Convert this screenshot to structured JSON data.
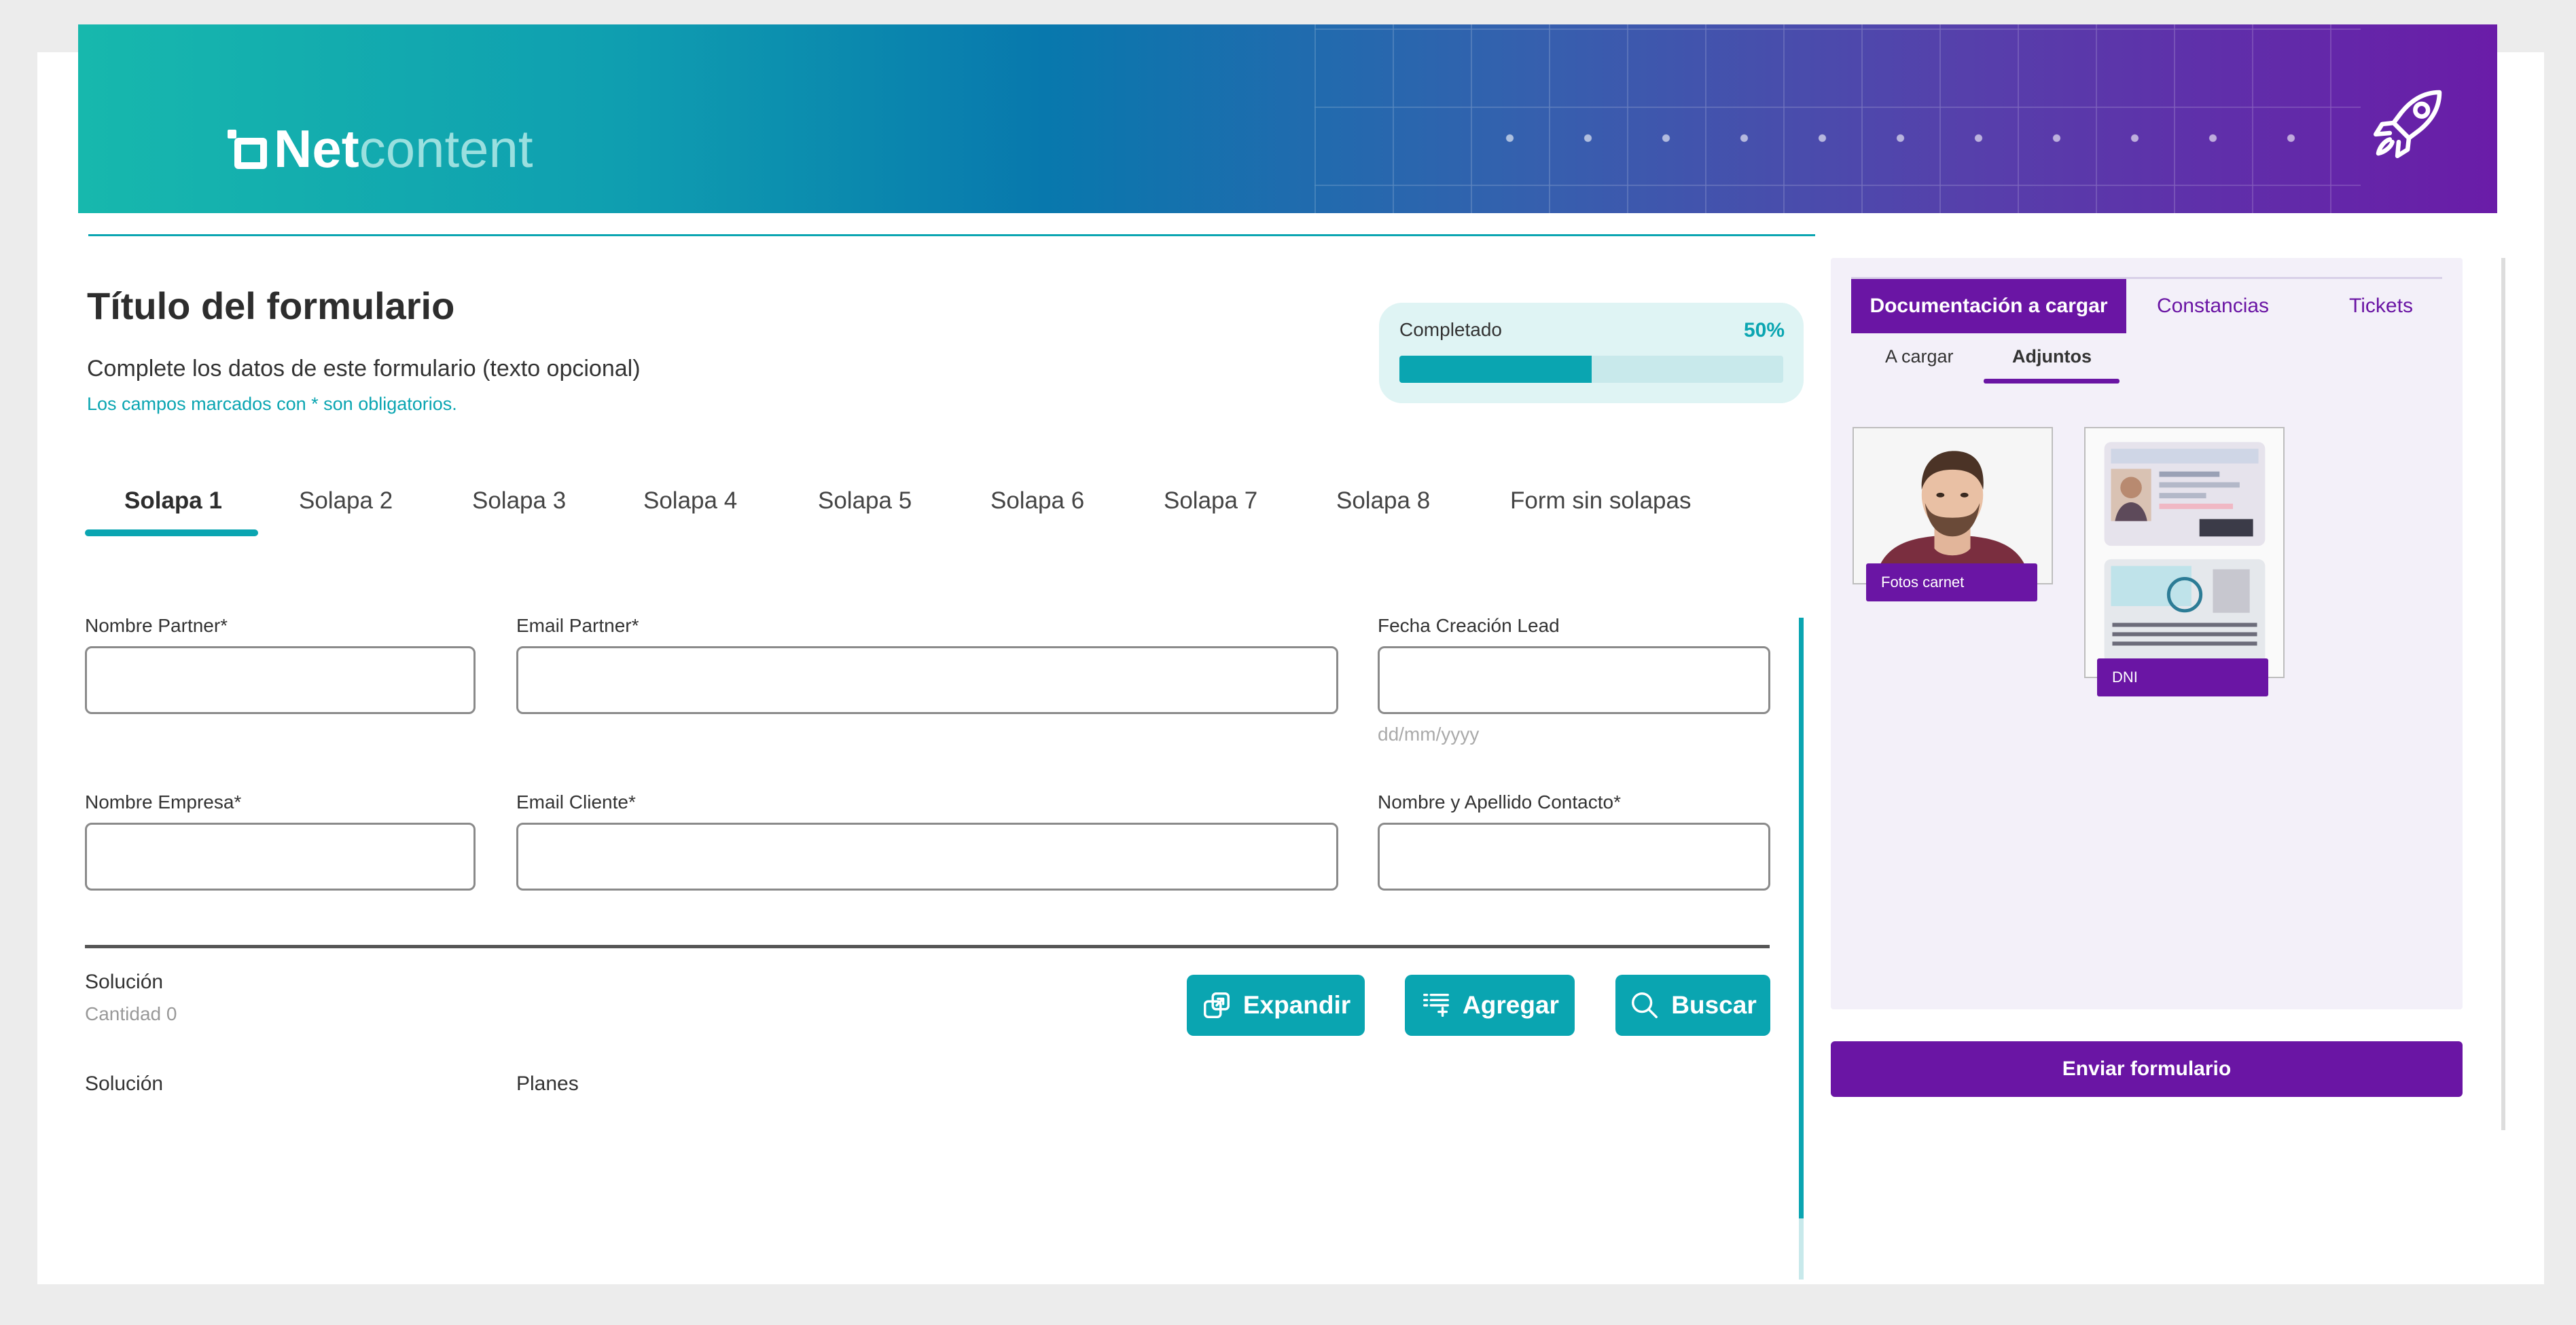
{
  "brand": {
    "name_bold": "Net",
    "name_light": "content"
  },
  "header": {
    "rocket_icon": "rocket-icon"
  },
  "form": {
    "title": "Título del formulario",
    "subtitle": "Complete los datos de este formulario (texto opcional)",
    "required_note": "Los campos marcados con * son obligatorios."
  },
  "progress": {
    "label": "Completado",
    "percent_text": "50%",
    "value": 0.5
  },
  "tabs": [
    "Solapa 1",
    "Solapa 2",
    "Solapa 3",
    "Solapa 4",
    "Solapa 5",
    "Solapa 6",
    "Solapa 7",
    "Solapa 8",
    "Form sin solapas"
  ],
  "active_tab": "Solapa 1",
  "fields": {
    "nombre_partner": {
      "label": "Nombre Partner*",
      "value": ""
    },
    "email_partner": {
      "label": "Email Partner*",
      "value": ""
    },
    "fecha_creacion": {
      "label": "Fecha Creación Lead",
      "value": "",
      "hint": "dd/mm/yyyy"
    },
    "nombre_empresa": {
      "label": "Nombre Empresa*",
      "value": ""
    },
    "email_cliente": {
      "label": "Email Cliente*",
      "value": ""
    },
    "nombre_contacto": {
      "label": "Nombre y Apellido Contacto*",
      "value": ""
    }
  },
  "solucion": {
    "label": "Solución",
    "count": "Cantidad 0",
    "buttons": {
      "expandir": "Expandir",
      "agregar": "Agregar",
      "buscar": "Buscar"
    },
    "columns": [
      "Solución",
      "Planes"
    ]
  },
  "side": {
    "tabs": [
      "Documentación a cargar",
      "Constancias",
      "Tickets"
    ],
    "active_tab": "Documentación a cargar",
    "subtabs": [
      "A cargar",
      "Adjuntos"
    ],
    "active_subtab": "Adjuntos",
    "attachments": [
      {
        "label": "Fotos carnet",
        "icon": "portrait-photo"
      },
      {
        "label": "DNI",
        "icon": "id-card-photo"
      }
    ],
    "send_button": "Enviar formulario"
  },
  "colors": {
    "accent": "#0aa5b1",
    "purple": "#6a15a4",
    "side_bg": "#f3f0f9"
  }
}
